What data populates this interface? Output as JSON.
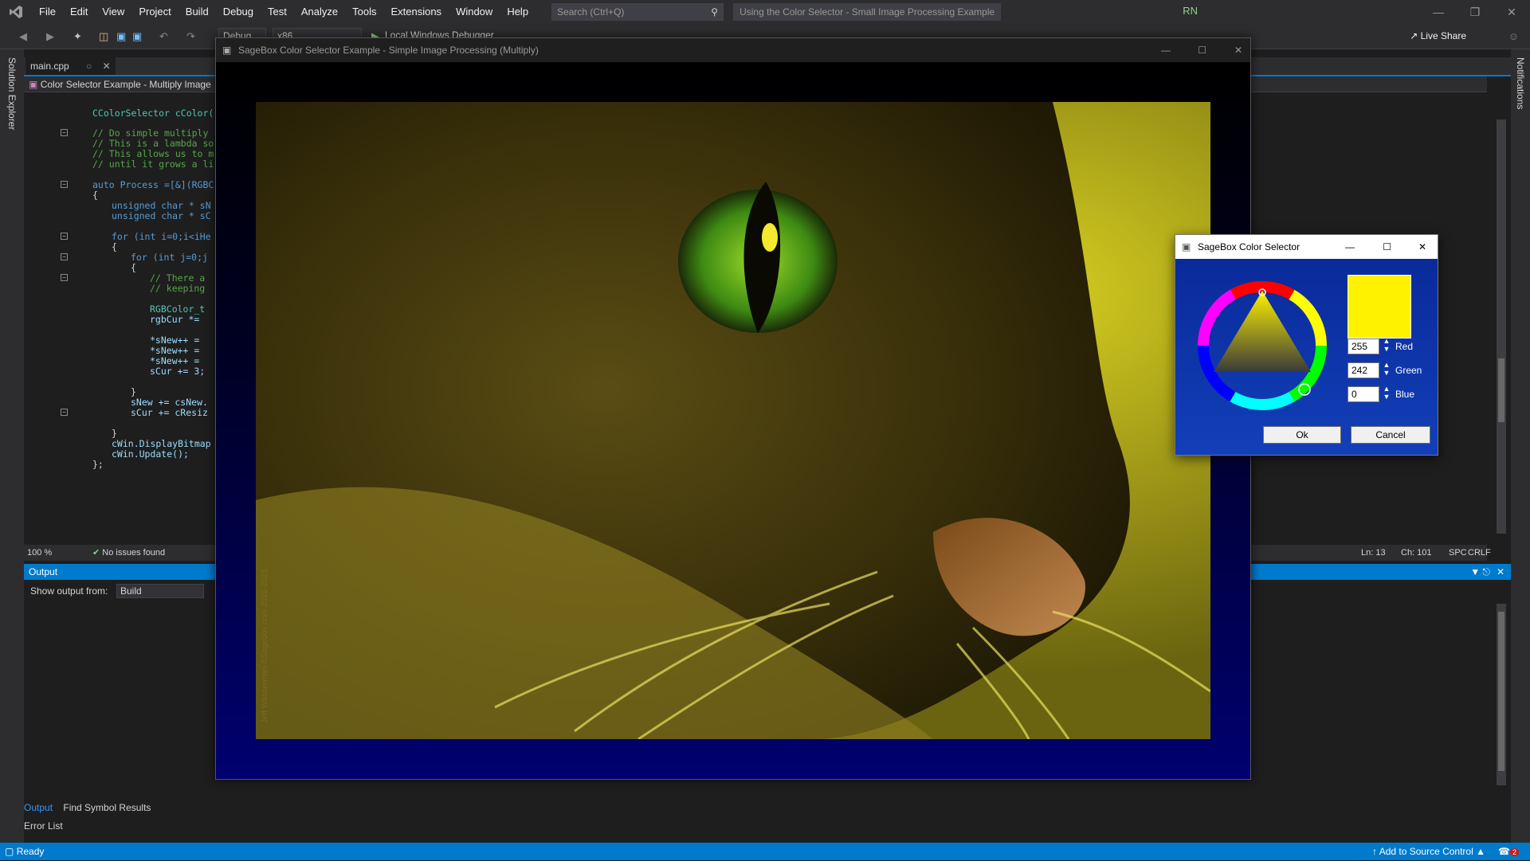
{
  "menu": [
    "File",
    "Edit",
    "View",
    "Project",
    "Build",
    "Debug",
    "Test",
    "Analyze",
    "Tools",
    "Extensions",
    "Window",
    "Help"
  ],
  "search": {
    "placeholder": "Search (Ctrl+Q)"
  },
  "doc_title": "Using the Color Selector  - Small Image Processing Example",
  "user_initials": "RN",
  "toolbar": {
    "config": "Debug",
    "platform": "x86",
    "debugger": "Local Windows Debugger",
    "live_share": "Live Share"
  },
  "rails": {
    "left": "Solution Explorer",
    "right": "Notifications"
  },
  "editor": {
    "tab": "main.cpp",
    "nav": "Color Selector Example - Multiply Image",
    "zoom": "100 %",
    "issues": "No issues found",
    "ln": "Ln: 13",
    "ch": "Ch: 101",
    "spc": "SPC",
    "crlf": "CRLF",
    "lines": [
      {
        "indent": 0,
        "text": "CColorSelector cColor(",
        "cls": "ty"
      },
      {
        "indent": 0,
        "text": "// Do simple multiply",
        "cls": "cm"
      },
      {
        "indent": 0,
        "text": "// This is a lambda so",
        "cls": "cm"
      },
      {
        "indent": 0,
        "text": "// This allows us to m",
        "cls": "cm"
      },
      {
        "indent": 0,
        "text": "// until it grows a li",
        "cls": "cm"
      },
      {
        "indent": 0,
        "text": "auto Process =[&](RGBC",
        "cls": "kw"
      },
      {
        "indent": 0,
        "text": "{",
        "cls": ""
      },
      {
        "indent": 1,
        "text": "unsigned char * sN",
        "cls": "kw"
      },
      {
        "indent": 1,
        "text": "unsigned char * sC",
        "cls": "kw"
      },
      {
        "indent": 1,
        "text": "for (int i=0;i<iHe",
        "cls": "kw"
      },
      {
        "indent": 1,
        "text": "{",
        "cls": ""
      },
      {
        "indent": 2,
        "text": "for (int j=0;j",
        "cls": "kw"
      },
      {
        "indent": 2,
        "text": "{",
        "cls": ""
      },
      {
        "indent": 3,
        "text": "// There a",
        "cls": "cm"
      },
      {
        "indent": 3,
        "text": "// keeping",
        "cls": "cm"
      },
      {
        "indent": 3,
        "text": "RGBColor_t",
        "cls": "ty"
      },
      {
        "indent": 3,
        "text": "rgbCur *=",
        "cls": "vr"
      },
      {
        "indent": 3,
        "text": "*sNew++ =",
        "cls": "vr"
      },
      {
        "indent": 3,
        "text": "*sNew++ =",
        "cls": "vr"
      },
      {
        "indent": 3,
        "text": "*sNew++ =",
        "cls": "vr"
      },
      {
        "indent": 3,
        "text": "sCur += 3;",
        "cls": "vr"
      },
      {
        "indent": 2,
        "text": "}",
        "cls": ""
      },
      {
        "indent": 2,
        "text": "sNew += csNew.",
        "cls": "vr"
      },
      {
        "indent": 2,
        "text": "sCur += cResiz",
        "cls": "vr"
      },
      {
        "indent": 1,
        "text": "}",
        "cls": ""
      },
      {
        "indent": 1,
        "text": "cWin.DisplayBitmap",
        "cls": "vr"
      },
      {
        "indent": 1,
        "text": "cWin.Update();",
        "cls": "vr"
      },
      {
        "indent": 0,
        "text": "};",
        "cls": ""
      }
    ]
  },
  "output": {
    "title": "Output",
    "show_from_label": "Show output from:",
    "source": "Build",
    "tabs": [
      "Output",
      "Find Symbol Results"
    ],
    "error_list": "Error List"
  },
  "statusbar": {
    "ready": "Ready",
    "source_control": "Add to Source Control",
    "notif_count": "2"
  },
  "sage_window": {
    "title": "SageBox Color Selector Example - Simple Image Processing (Multiply)",
    "watermark": "Jeff Wasserman ©Sagebox.com 2020-2021"
  },
  "color_dialog": {
    "title": "SageBox Color Selector",
    "red": "255",
    "green": "242",
    "blue": "0",
    "red_label": "Red",
    "green_label": "Green",
    "blue_label": "Blue",
    "ok": "Ok",
    "cancel": "Cancel",
    "swatch_color": "#fff200"
  },
  "colors": {
    "accent": "#007acc",
    "editor_bg": "#1e1e1e",
    "chrome": "#2d2d30"
  }
}
